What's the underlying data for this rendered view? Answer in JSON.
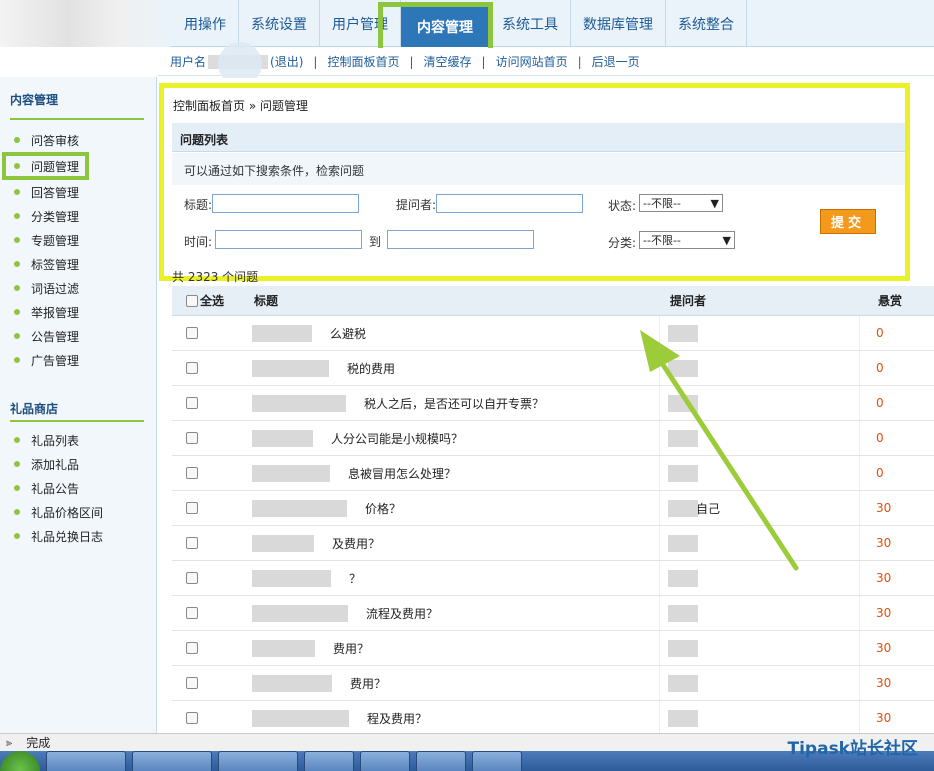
{
  "nav": {
    "tabs": [
      "用操作",
      "系统设置",
      "用户管理",
      "内容管理",
      "系统工具",
      "数据库管理",
      "系统整合"
    ],
    "active_index": 3
  },
  "subnav": {
    "user_prefix": "用户名",
    "logout": "退出",
    "links": [
      "控制面板首页",
      "清空缓存",
      "访问网站首页",
      "后退一页"
    ]
  },
  "sidebar": {
    "section1_title": "内容管理",
    "section1_items": [
      "问答审核",
      "问题管理",
      "回答管理",
      "分类管理",
      "专题管理",
      "标签管理",
      "词语过滤",
      "举报管理",
      "公告管理",
      "广告管理"
    ],
    "section1_active": 1,
    "section2_title": "礼品商店",
    "section2_items": [
      "礼品列表",
      "添加礼品",
      "礼品公告",
      "礼品价格区间",
      "礼品兑换日志"
    ]
  },
  "breadcrumb": "控制面板首页 » 问题管理",
  "panel": {
    "title": "问题列表",
    "tip": "可以通过如下搜索条件，检索问题",
    "title_label": "标题:",
    "asker_label": "提问者:",
    "status_label": "状态:",
    "status_value": "--不限--",
    "time_label": "时间:",
    "to_label": "到",
    "category_label": "分类:",
    "category_value": "--不限--",
    "submit": "提交"
  },
  "count_text": "共 2323 个问题",
  "table": {
    "headers": {
      "select_all": "全选",
      "title": "标题",
      "asker": "提问者",
      "reward": "悬赏"
    },
    "rows": [
      {
        "title": "么避税",
        "asker": "",
        "reward": "0"
      },
      {
        "title": "税的费用",
        "asker": "",
        "reward": "0"
      },
      {
        "title": "税人之后，是否还可以自开专票？",
        "asker": "",
        "reward": "0"
      },
      {
        "title": "人分公司能是小规模吗？",
        "asker": "",
        "reward": "0"
      },
      {
        "title": "息被冒用怎么处理？",
        "asker": "",
        "reward": "0"
      },
      {
        "title": "价格？",
        "asker": "自己",
        "reward": "30"
      },
      {
        "title": "及费用？",
        "asker": "",
        "reward": "30"
      },
      {
        "title": "？",
        "asker": "",
        "reward": "30"
      },
      {
        "title": "流程及费用？",
        "asker": "",
        "reward": "30"
      },
      {
        "title": "费用？",
        "asker": "",
        "reward": "30"
      },
      {
        "title": "费用？",
        "asker": "",
        "reward": "30"
      },
      {
        "title": "程及费用？",
        "asker": "",
        "reward": "30"
      }
    ]
  },
  "status_bar": {
    "text": "完成"
  },
  "watermark": "Tipask站长社区",
  "colors": {
    "accent_green": "#8cc63f",
    "highlight_yellow": "#eaf227",
    "nav_active": "#2d77b8",
    "submit": "#f39a1d",
    "reward": "#e24f0b"
  }
}
